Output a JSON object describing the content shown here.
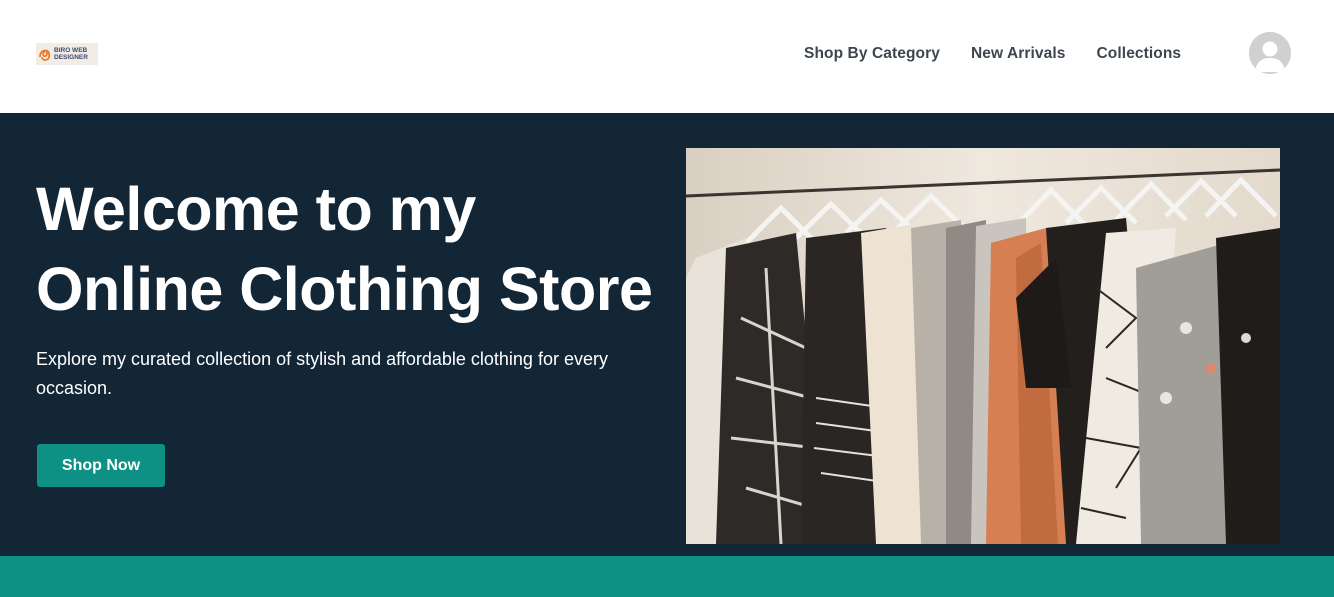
{
  "logo": {
    "line1": "BIRO WEB",
    "line2": "DESIGNER"
  },
  "nav": [
    {
      "label": "Shop By Category"
    },
    {
      "label": "New Arrivals"
    },
    {
      "label": "Collections"
    }
  ],
  "hero": {
    "title_line1": "Welcome to my",
    "title_line2": "Online Clothing Store",
    "subtitle": "Explore my curated collection of stylish and affordable clothing for every occasion.",
    "cta_label": "Shop Now"
  },
  "colors": {
    "hero_bg": "#132636",
    "accent": "#0e9184",
    "nav_text": "#3d4650"
  }
}
